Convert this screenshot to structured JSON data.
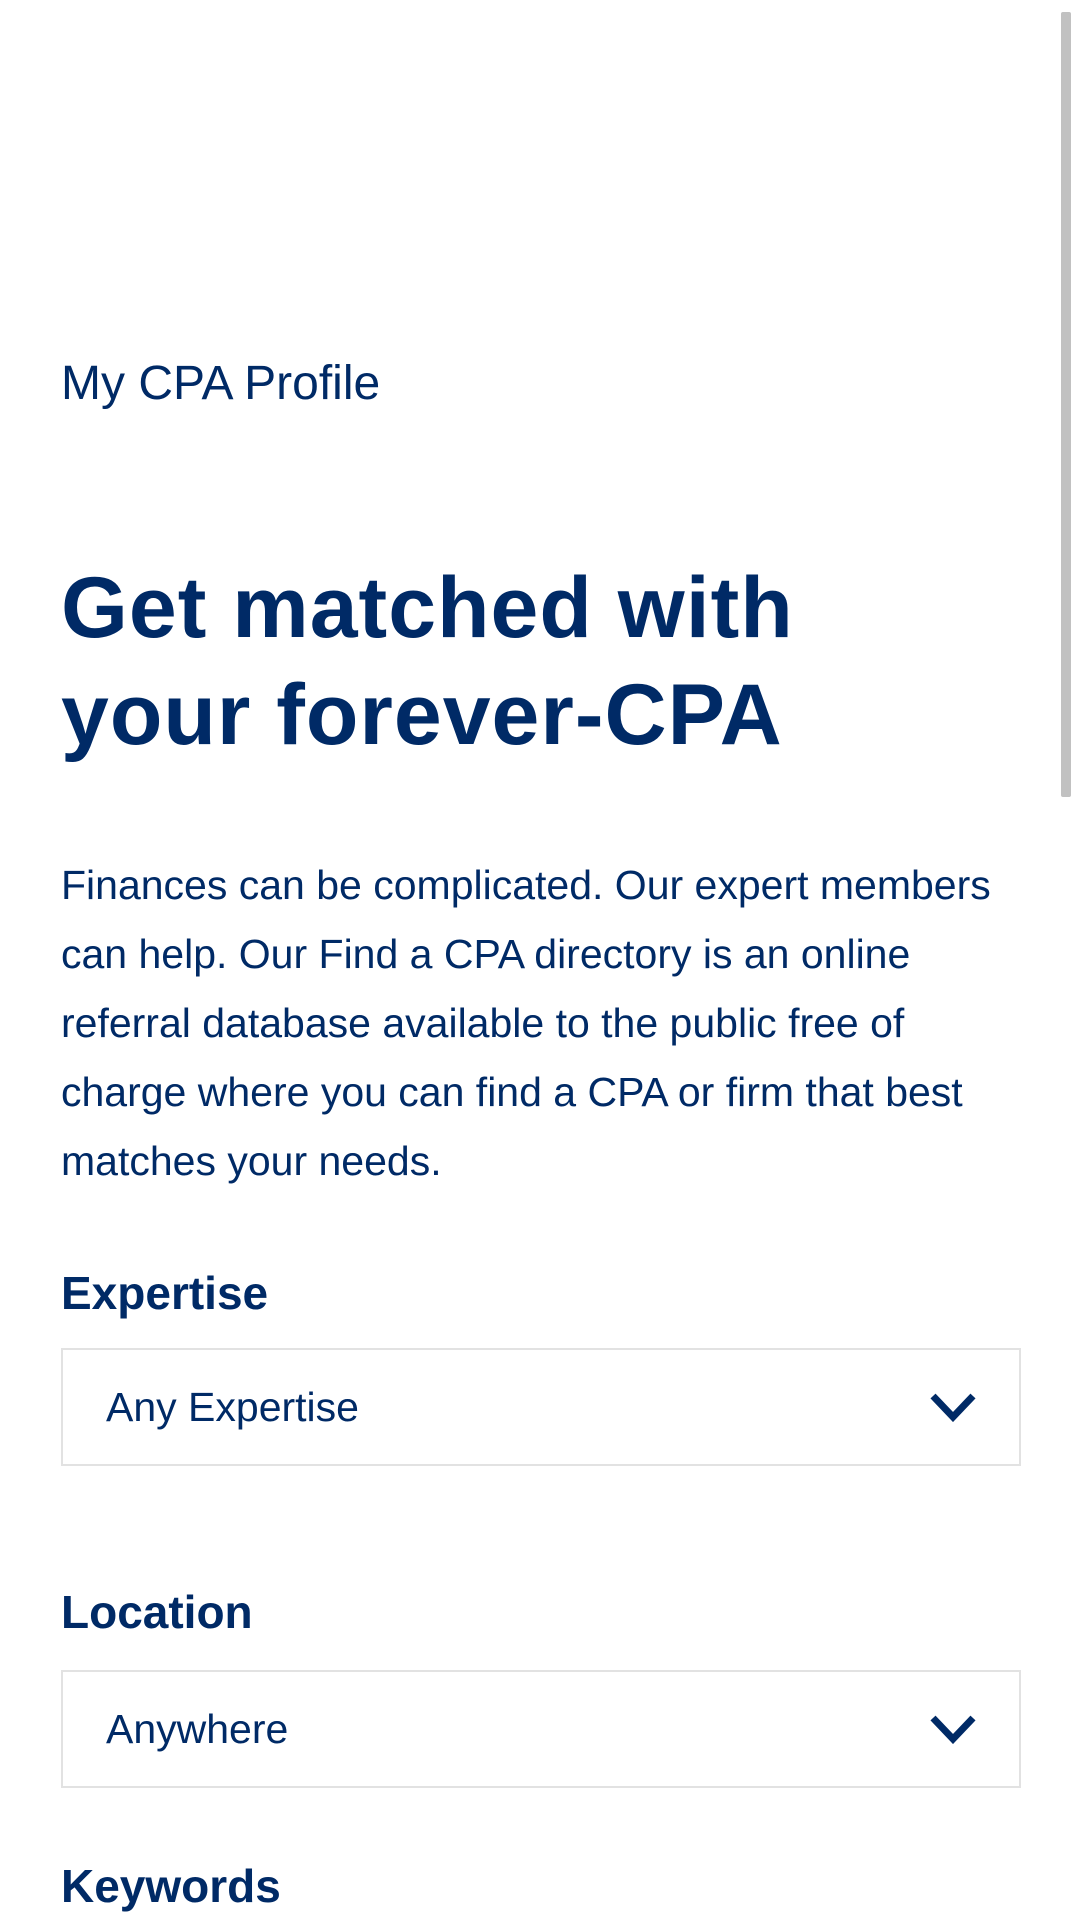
{
  "profile_link": "My CPA Profile",
  "headline": {
    "line1": "Get matched with",
    "line2": "your forever-CPA"
  },
  "intro": "Finances can be complicated. Our expert members can help. Our Find a CPA directory is an online referral database available to the public free of charge where you can find a CPA or firm that best matches your needs.",
  "form": {
    "expertise": {
      "label": "Expertise",
      "value": "Any Expertise"
    },
    "location": {
      "label": "Location",
      "value": "Anywhere"
    },
    "keywords": {
      "label": "Keywords"
    }
  },
  "colors": {
    "primary": "#002a66",
    "border": "#e2e2e2"
  }
}
